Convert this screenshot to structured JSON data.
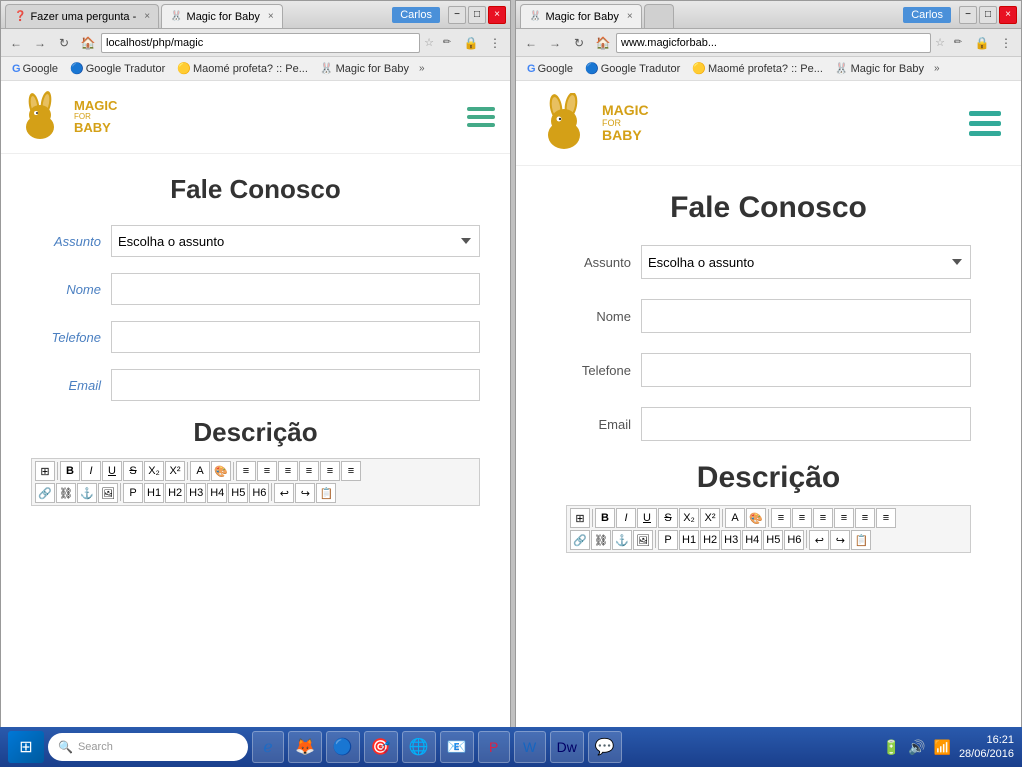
{
  "window_left": {
    "user": "Carlos",
    "tabs": [
      {
        "label": "Fazer uma pergunta -",
        "active": false,
        "favicon": "❓"
      },
      {
        "label": "Magic for Baby",
        "active": true,
        "favicon": "🐰"
      }
    ],
    "address": "localhost/php/magic",
    "bookmarks": [
      "Google",
      "Google Tradutor",
      "Maomé profeta? :: Pe...",
      "Magic for Baby"
    ],
    "controls": {
      "minimize": "−",
      "maximize": "□",
      "close": "×"
    },
    "site": {
      "logo_text_top": "magic",
      "logo_text_for": "for",
      "logo_text_bottom": "baby",
      "hamburger": "☰",
      "title": "Fale Conosco",
      "form": {
        "assunto_label": "Assunto",
        "assunto_placeholder": "Escolha o assunto",
        "nome_label": "Nome",
        "telefone_label": "Telefone",
        "email_label": "Email",
        "descricao_title": "Descrição"
      },
      "editor_buttons": [
        "⬛",
        "B",
        "I",
        "U",
        "S",
        "X₂",
        "X²",
        "🖊",
        "🎨",
        "≡",
        "≡",
        "≡",
        "≡",
        "≡",
        "≡"
      ]
    }
  },
  "window_right": {
    "user": "Carlos",
    "tabs": [
      {
        "label": "Magic for Baby",
        "active": true,
        "favicon": "🐰"
      }
    ],
    "address": "www.magicforbab...",
    "bookmarks": [
      "Google",
      "Google Tradutor",
      "Maomé profeta? :: Pe...",
      "Magic for Baby"
    ],
    "controls": {
      "minimize": "−",
      "maximize": "□",
      "close": "×"
    },
    "site": {
      "title": "Fale Conosco",
      "form": {
        "assunto_label": "Assunto",
        "assunto_placeholder": "Escolha o assunto",
        "nome_label": "Nome",
        "telefone_label": "Telefone",
        "email_label": "Email",
        "descricao_title": "Descrição"
      }
    }
  },
  "taskbar": {
    "time": "16:21",
    "date": "28/06/2016",
    "apps": [
      "IE",
      "Firefox",
      "Chrome",
      "?",
      "🌐",
      "Outlook",
      "PPT",
      "Word",
      "DW",
      "Skype",
      "?",
      "?"
    ]
  }
}
